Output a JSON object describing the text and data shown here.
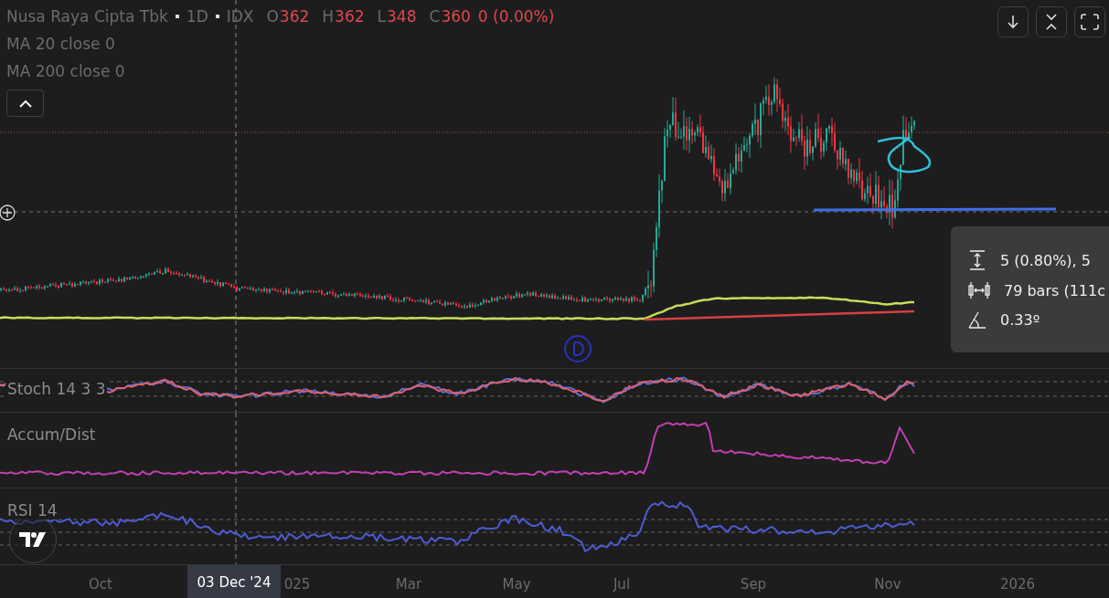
{
  "legend": {
    "symbol": "Nusa Raya Cipta Tbk",
    "interval": "1D",
    "exchange": "IDX",
    "ohlc": [
      {
        "key": "O",
        "value": "362"
      },
      {
        "key": "H",
        "value": "362"
      },
      {
        "key": "L",
        "value": "348"
      },
      {
        "key": "C",
        "value": "360"
      }
    ],
    "change": "0 (0.00%)"
  },
  "indicators": [
    {
      "label": "MA 20 close 0"
    },
    {
      "label": "MA 200 close 0"
    }
  ],
  "top_buttons": [
    {
      "kind": "download"
    },
    {
      "kind": "collapse"
    },
    {
      "kind": "fullscreen"
    }
  ],
  "measure": [
    {
      "kind": "price",
      "text": "5 (0.80%), 5"
    },
    {
      "kind": "bars",
      "text": "79 bars (111c"
    },
    {
      "kind": "angle",
      "text": "0.33º"
    }
  ],
  "panes": [
    {
      "kind": "stoch",
      "label": "Stoch 14 3 3"
    },
    {
      "kind": "accum",
      "label": "Accum/Dist"
    },
    {
      "kind": "rsi",
      "label": "RSI 14"
    }
  ],
  "time_axis": [
    "Oct",
    "025",
    "Mar",
    "May",
    "Jul",
    "Sep",
    "Nov",
    "2026"
  ],
  "crosshair_label": "03 Dec '24"
}
